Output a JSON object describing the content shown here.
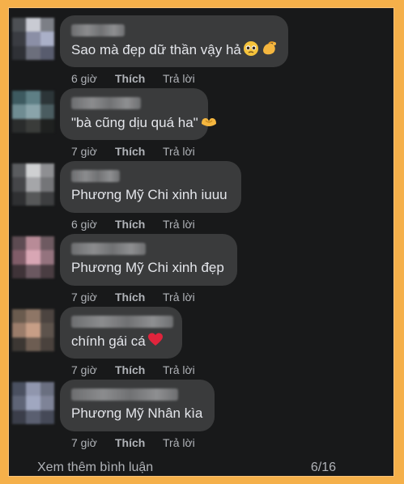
{
  "comments": [
    {
      "text": "Sao mà đẹp dữ thần vậy hả",
      "emoji": [
        "pleading-face-emoji",
        "pinched-fingers-emoji"
      ],
      "time": "6 giờ",
      "like": "Thích",
      "reply": "Trả lời",
      "avatar_colors": [
        "#4d5054",
        "#c9cbd3",
        "#7c7f86",
        "#3a3c42",
        "#8b8fa6",
        "#aab0c8",
        "#2f3136",
        "#6c6f7c",
        "#585c6e"
      ]
    },
    {
      "text": "\"bà cũng dịu quá ha\"",
      "emoji": [
        "heart-hands-emoji"
      ],
      "time": "7 giờ",
      "like": "Thích",
      "reply": "Trả lời",
      "avatar_colors": [
        "#3d5a60",
        "#5e7f85",
        "#2c3538",
        "#6f8c92",
        "#8aa4aa",
        "#4a5c60",
        "#2a2c2c",
        "#3a3c3a",
        "#1f2120"
      ]
    },
    {
      "text": "Phương Mỹ Chi xinh iuuu",
      "emoji": [],
      "time": "6 giờ",
      "like": "Thích",
      "reply": "Trả lời",
      "avatar_colors": [
        "#5a5c5f",
        "#cfd0d2",
        "#8e8f92",
        "#454649",
        "#a5a6a9",
        "#747578",
        "#2f3032",
        "#575859",
        "#3d3e40"
      ]
    },
    {
      "text": "Phương Mỹ Chi xinh đẹp",
      "emoji": [],
      "time": "7 giờ",
      "like": "Thích",
      "reply": "Trả lời",
      "avatar_colors": [
        "#5d4b52",
        "#b88b97",
        "#6e5a61",
        "#805c68",
        "#d8a6b4",
        "#94737e",
        "#3f3338",
        "#6b5860",
        "#4a3d42"
      ]
    },
    {
      "text": "chính gái cá",
      "emoji": [
        "red-heart-emoji"
      ],
      "time": "7 giờ",
      "like": "Thích",
      "reply": "Trả lời",
      "avatar_colors": [
        "#6a5b4e",
        "#8e7666",
        "#4c4440",
        "#9a7c6a",
        "#c79e86",
        "#5d534c",
        "#3c3733",
        "#6d5d52",
        "#4a423d"
      ]
    },
    {
      "text": "Phương Mỹ Nhân kìa",
      "emoji": [],
      "time": "7 giờ",
      "like": "Thích",
      "reply": "Trả lời",
      "avatar_colors": [
        "#4a5060",
        "#9096ad",
        "#6a6f80",
        "#5e6476",
        "#a0a7c0",
        "#7e8397",
        "#3b3e4a",
        "#5a5f70",
        "#454957"
      ]
    }
  ],
  "footer": {
    "more_comments": "Xem thêm bình luận",
    "page_count": "6/16"
  },
  "colors": {
    "frame_border": "#f5b04a",
    "panel_background": "#18191a",
    "bubble_background": "#3a3b3c",
    "primary_text": "#e4e6eb",
    "secondary_text": "#b0b3b8"
  }
}
